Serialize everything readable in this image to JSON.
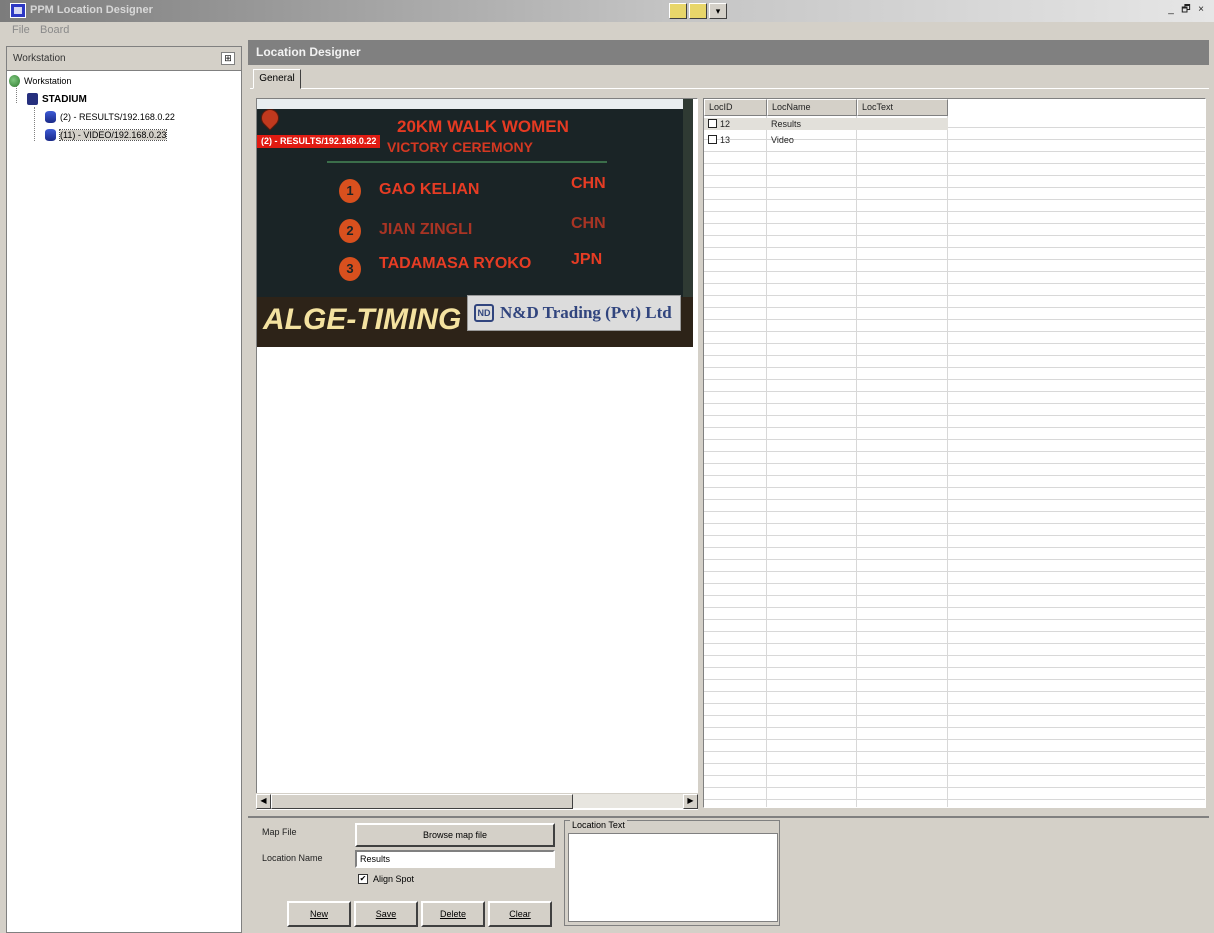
{
  "window": {
    "title": "PPM Location Designer",
    "controls": [
      "_",
      "🗗",
      "×"
    ]
  },
  "menu": [
    "File",
    "Board"
  ],
  "workstations": {
    "header": "Workstation",
    "tree": {
      "root": "Workstation",
      "group": "STADIUM",
      "items": [
        "(2) - RESULTS/192.168.0.22",
        "(11) - VIDEO/192.168.0.23"
      ]
    }
  },
  "main": {
    "title": "Location Designer",
    "tab": "General"
  },
  "map": {
    "marker_label": "(2) - RESULTS/192.168.0.22",
    "board": {
      "title": "20KM WALK WOMEN",
      "subtitle": "VICTORY CEREMONY",
      "rows": [
        {
          "rank": "1",
          "name": "GAO KELIAN",
          "nation": "CHN"
        },
        {
          "rank": "2",
          "name": "JIAN ZINGLI",
          "nation": "CHN"
        },
        {
          "rank": "3",
          "name": "TADAMASA RYOKO",
          "nation": "JPN"
        }
      ],
      "sponsor1": "ALGE-TIMING",
      "sponsor2": "N&D Trading (Pvt) Ltd",
      "sponsor2_logo": "ND"
    }
  },
  "grid": {
    "columns": [
      "LocID",
      "LocName",
      "LocText"
    ],
    "rows": [
      {
        "id": "12",
        "name": "Results",
        "text": ""
      },
      {
        "id": "13",
        "name": "Video",
        "text": ""
      }
    ]
  },
  "form": {
    "map_file_label": "Map File",
    "browse_label": "Browse map file",
    "location_name_label": "Location Name",
    "location_name_value": "Results",
    "align_spot_label": "Align Spot",
    "align_spot_checked": "✔",
    "location_text_label": "Location Text",
    "buttons": {
      "new": "New",
      "save": "Save",
      "delete": "Delete",
      "clear": "Clear"
    }
  }
}
